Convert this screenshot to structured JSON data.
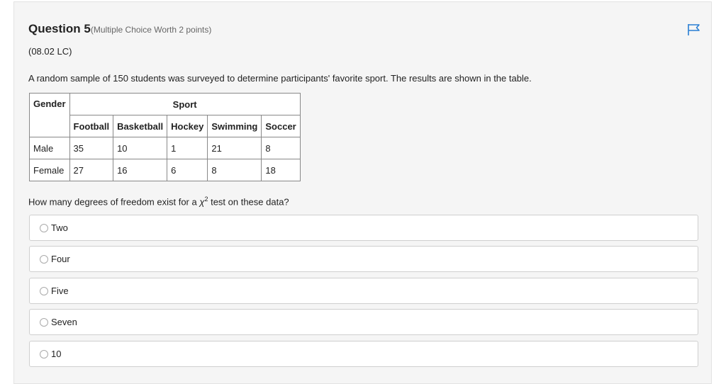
{
  "question": {
    "title": "Question 5",
    "worth": "(Multiple Choice Worth 2 points)",
    "code": "(08.02 LC)",
    "stem": "A random sample of 150 students was surveyed to determine participants' favorite sport. The results are shown in the table.",
    "ask_before": "How many degrees of freedom exist for a ",
    "ask_symbol": "χ",
    "ask_sup": "2",
    "ask_after": " test on these data?"
  },
  "table": {
    "gender_header": "Gender",
    "sport_header": "Sport",
    "columns": [
      "Football",
      "Basketball",
      "Hockey",
      "Swimming",
      "Soccer"
    ],
    "rows": [
      {
        "label": "Male",
        "values": [
          "35",
          "10",
          "1",
          "21",
          "8"
        ]
      },
      {
        "label": "Female",
        "values": [
          "27",
          "16",
          "6",
          "8",
          "18"
        ]
      }
    ]
  },
  "options": [
    "Two",
    "Four",
    "Five",
    "Seven",
    "10"
  ],
  "colors": {
    "flag": "#2a7fd4",
    "panel_bg": "#f5f5f5"
  },
  "icons": {
    "flag": "flag-icon",
    "radio": "radio-icon"
  }
}
